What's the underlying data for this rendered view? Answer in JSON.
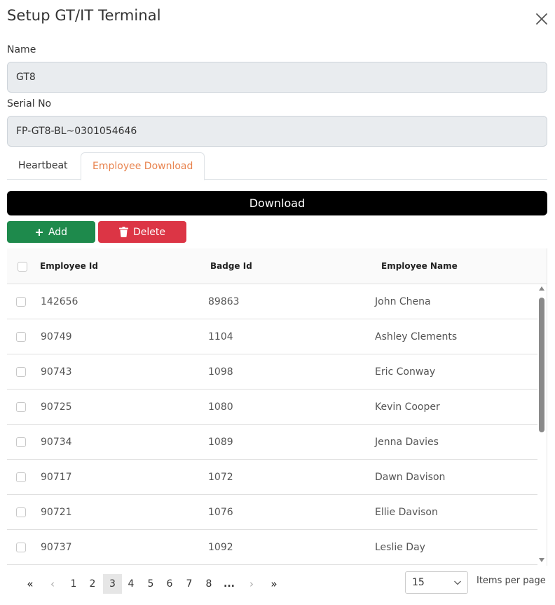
{
  "dialog": {
    "title": "Setup GT/IT Terminal"
  },
  "form": {
    "name_label": "Name",
    "name_value": "GT8",
    "serial_label": "Serial No",
    "serial_value": "FP-GT8-BL~0301054646"
  },
  "tabs": [
    {
      "label": "Heartbeat",
      "active": false
    },
    {
      "label": "Employee Download",
      "active": true
    }
  ],
  "toolbar": {
    "download_label": "Download",
    "add_label": "Add",
    "delete_label": "Delete"
  },
  "grid": {
    "columns": [
      "Employee Id",
      "Badge Id",
      "Employee Name"
    ],
    "rows": [
      {
        "employee_id": "142656",
        "badge_id": "89863",
        "name": "John Chena"
      },
      {
        "employee_id": "90749",
        "badge_id": "1104",
        "name": "Ashley Clements"
      },
      {
        "employee_id": "90743",
        "badge_id": "1098",
        "name": "Eric Conway"
      },
      {
        "employee_id": "90725",
        "badge_id": "1080",
        "name": "Kevin Cooper"
      },
      {
        "employee_id": "90734",
        "badge_id": "1089",
        "name": "Jenna Davies"
      },
      {
        "employee_id": "90717",
        "badge_id": "1072",
        "name": "Dawn Davison"
      },
      {
        "employee_id": "90721",
        "badge_id": "1076",
        "name": "Ellie Davison"
      },
      {
        "employee_id": "90737",
        "badge_id": "1092",
        "name": "Leslie Day"
      }
    ]
  },
  "pager": {
    "first": "«",
    "prev": "‹",
    "pages": [
      "1",
      "2",
      "3",
      "4",
      "5",
      "6",
      "7",
      "8"
    ],
    "current_page": "3",
    "ellipsis": "...",
    "next": "›",
    "last": "»",
    "page_size": "15",
    "items_per_page_label": "Items per page"
  },
  "colors": {
    "tab_active": "#e8834e",
    "add_button": "#1e8a4c",
    "delete_button": "#dc3545",
    "download_button": "#000000"
  }
}
